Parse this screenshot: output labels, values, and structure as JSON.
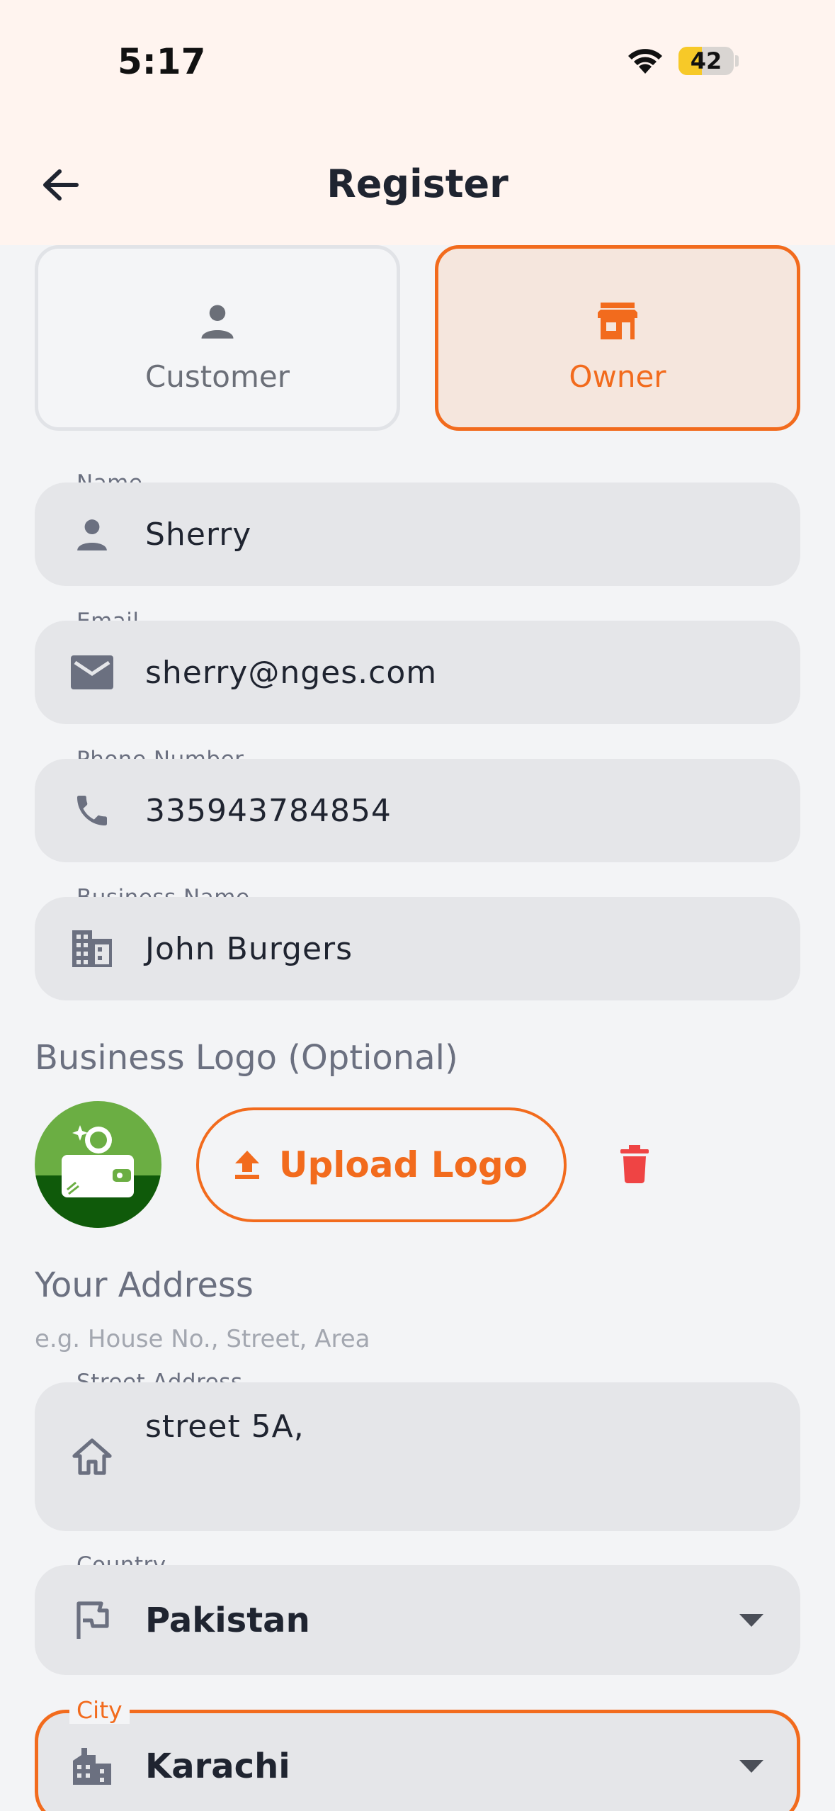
{
  "status_bar": {
    "time": "5:17",
    "battery": "42",
    "battery_level": 0.42
  },
  "header": {
    "title": "Register"
  },
  "roles": {
    "customer": {
      "label": "Customer",
      "icon": "person-icon",
      "selected": false
    },
    "owner": {
      "label": "Owner",
      "icon": "store-icon",
      "selected": true
    }
  },
  "fields": {
    "name": {
      "label": "Name",
      "value": "Sherry",
      "icon": "person-icon"
    },
    "email": {
      "label": "Email",
      "value": "sherry@nges.com",
      "icon": "mail-icon"
    },
    "phone": {
      "label": "Phone Number",
      "value": "335943784854",
      "icon": "phone-icon"
    },
    "business": {
      "label": "Business Name",
      "value": "John Burgers",
      "icon": "building-icon"
    }
  },
  "logo_section": {
    "title": "Business Logo (Optional)",
    "upload_label": "Upload Logo"
  },
  "address": {
    "title": "Your Address",
    "hint": "e.g. House No., Street, Area",
    "street": {
      "label": "Street Address",
      "value": "street 5A,",
      "icon": "home-icon"
    },
    "country": {
      "label": "Country",
      "value": "Pakistan",
      "icon": "flag-icon"
    },
    "city": {
      "label": "City",
      "value": "Karachi",
      "icon": "city-icon"
    }
  },
  "colors": {
    "accent": "#F26B1D",
    "header_bg": "#FFF4EF",
    "page_bg": "#F3F4F6",
    "field_bg": "#E5E6E9",
    "delete": "#EF4444"
  }
}
